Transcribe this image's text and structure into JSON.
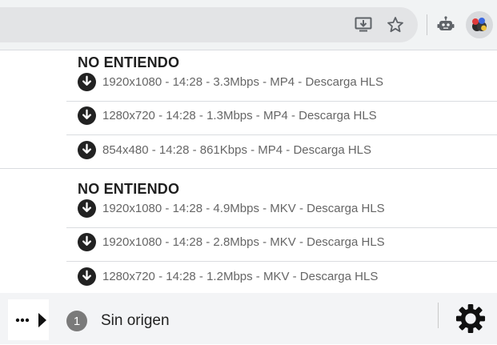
{
  "toolbar": {
    "icons": [
      "install-app-icon",
      "bookmark-star-icon",
      "robot-extension-icon",
      "video-downloader-extension-icon"
    ]
  },
  "groups": [
    {
      "title": "NO ENTIENDO",
      "items": [
        "1920x1080 - 14:28 - 3.3Mbps - MP4 - Descarga HLS",
        "1280x720 - 14:28 - 1.3Mbps - MP4 - Descarga HLS",
        "854x480 - 14:28 - 861Kbps - MP4 - Descarga HLS"
      ]
    },
    {
      "title": "NO ENTIENDO",
      "items": [
        "1920x1080 - 14:28 - 4.9Mbps - MKV - Descarga HLS",
        "1920x1080 - 14:28 - 2.8Mbps - MKV - Descarga HLS",
        "1280x720 - 14:28 - 1.2Mbps - MKV - Descarga HLS"
      ]
    }
  ],
  "footer": {
    "badge_count": "1",
    "origin_label": "Sin origen"
  }
}
